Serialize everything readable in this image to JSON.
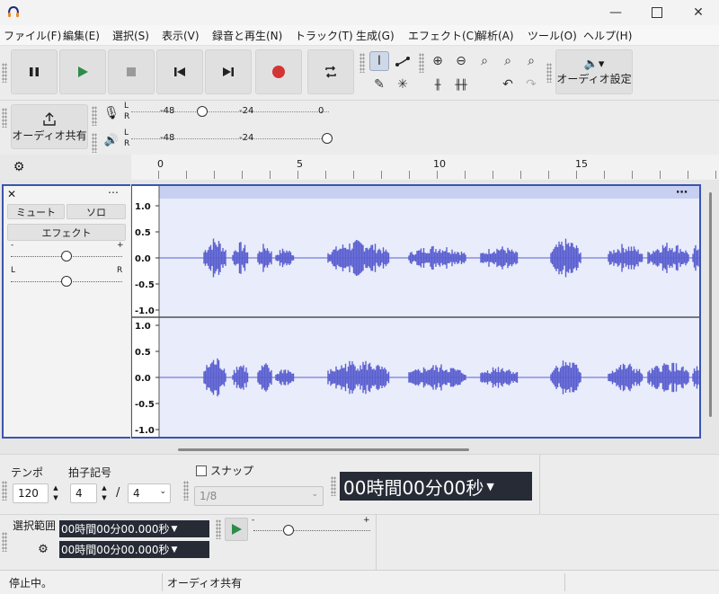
{
  "menu": [
    "ファイル(F)",
    "編集(E)",
    "選択(S)",
    "表示(V)",
    "録音と再生(N)",
    "トラック(T)",
    "生成(G)",
    "エフェクト(C)",
    "解析(A)",
    "ツール(O)",
    "ヘルプ(H)"
  ],
  "toolbar": {
    "audio_setup_label": "オーディオ設定",
    "share_audio_label": "オーディオ共有"
  },
  "meters": {
    "scale_labels": [
      "-48",
      "-24",
      "0"
    ],
    "left_channel": "L",
    "right_channel": "R"
  },
  "ruler": {
    "ticks": [
      "0",
      "5",
      "10",
      "15"
    ]
  },
  "track": {
    "name": "",
    "mute_label": "ミュート",
    "solo_label": "ソロ",
    "effects_label": "エフェクト",
    "gain_minus": "-",
    "gain_plus": "+",
    "pan_left": "L",
    "pan_right": "R",
    "y_labels": [
      "1.0",
      "0.5",
      "0.0",
      "-0.5",
      "-1.0"
    ],
    "gain_level": 0.5,
    "pan_level": 0.5
  },
  "bottom": {
    "tempo_label": "テンポ",
    "tempo_value": "120",
    "timesig_label": "拍子記号",
    "timesig_num": "4",
    "timesig_den": "4",
    "timesig_slash": "/",
    "snap_label": "スナップ",
    "snap_value": "1/8",
    "time_display": "00時間00分00秒",
    "selection_label": "選択範囲",
    "sel_start": "00時間00分00.000秒",
    "sel_end": "00時間00分00.000秒",
    "speed_minus": "-",
    "speed_plus": "+",
    "speed_level": 0.3
  },
  "status": {
    "left": "停止中。",
    "right": "オーディオ共有"
  },
  "colors": {
    "waveform": "#5a5fd0",
    "track_border": "#3a55b0",
    "record": "#d33434",
    "play": "#2e8b4a"
  }
}
